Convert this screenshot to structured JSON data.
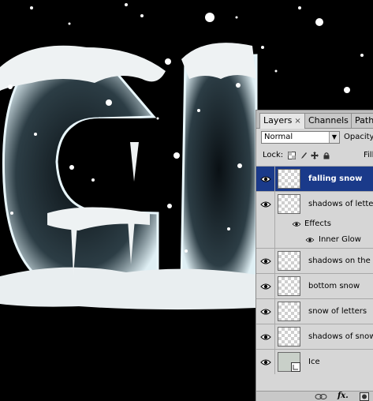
{
  "panel": {
    "tabs": [
      {
        "label": "Layers",
        "close": "×"
      },
      {
        "label": "Channels"
      },
      {
        "label": "Paths"
      }
    ],
    "blend_mode": "Normal",
    "opacity_label": "Opacity",
    "lock_label": "Lock:",
    "fill_label": "Fill",
    "layers": [
      {
        "name": "falling snow",
        "selected": true
      },
      {
        "name": "shadows of letters"
      },
      {
        "name": "shadows on the surface"
      },
      {
        "name": "bottom snow"
      },
      {
        "name": "snow of  letters"
      },
      {
        "name": "shadows of snow"
      },
      {
        "name": "Ice"
      }
    ],
    "effects_label": "Effects",
    "inner_glow_label": "Inner Glow",
    "footer_icons": [
      "link-icon",
      "fx-icon",
      "mask-icon"
    ],
    "fx_label": "fx."
  },
  "colors": {
    "background": "#000000",
    "selection": "#1a3a8a",
    "panel": "#d6d6d6"
  }
}
